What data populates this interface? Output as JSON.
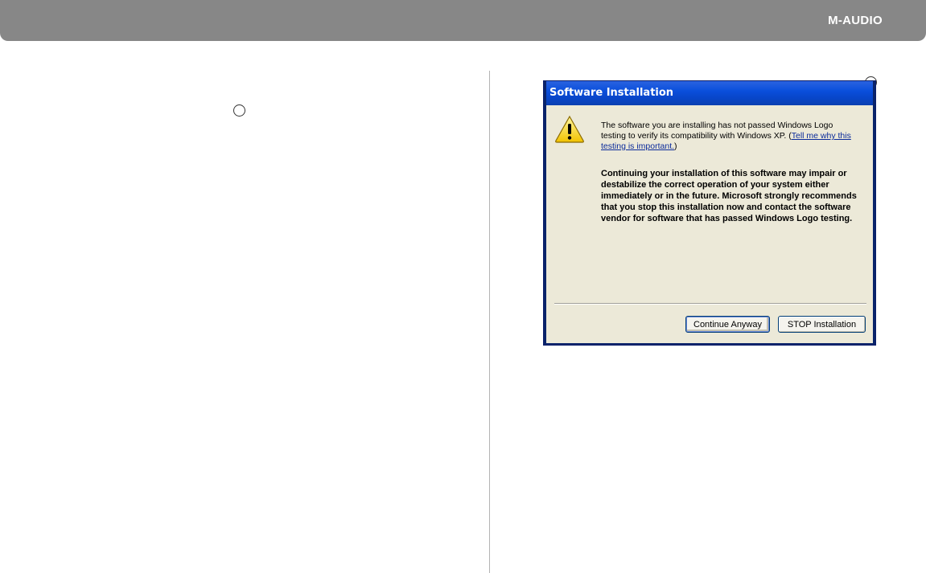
{
  "header": {
    "brand": "M-AUDIO",
    "bg_color": "#878787"
  },
  "dialog": {
    "title": "Software Installation",
    "icon": "warning-icon",
    "message_prefix": "The software you are installing has not passed Windows Logo testing to verify its compatibility with Windows XP. (",
    "message_link": "Tell me why this testing is important.",
    "message_suffix": ")",
    "warning_text": "Continuing your installation of this software may impair or destabilize the correct operation of your system either immediately or in the future. Microsoft strongly recommends that you stop this installation now and contact the software vendor for software that has passed Windows Logo testing.",
    "buttons": {
      "continue_label": "Continue Anyway",
      "stop_label": "STOP Installation"
    },
    "titlebar_color": "#0a4fdc",
    "body_color": "#ece9d8"
  }
}
